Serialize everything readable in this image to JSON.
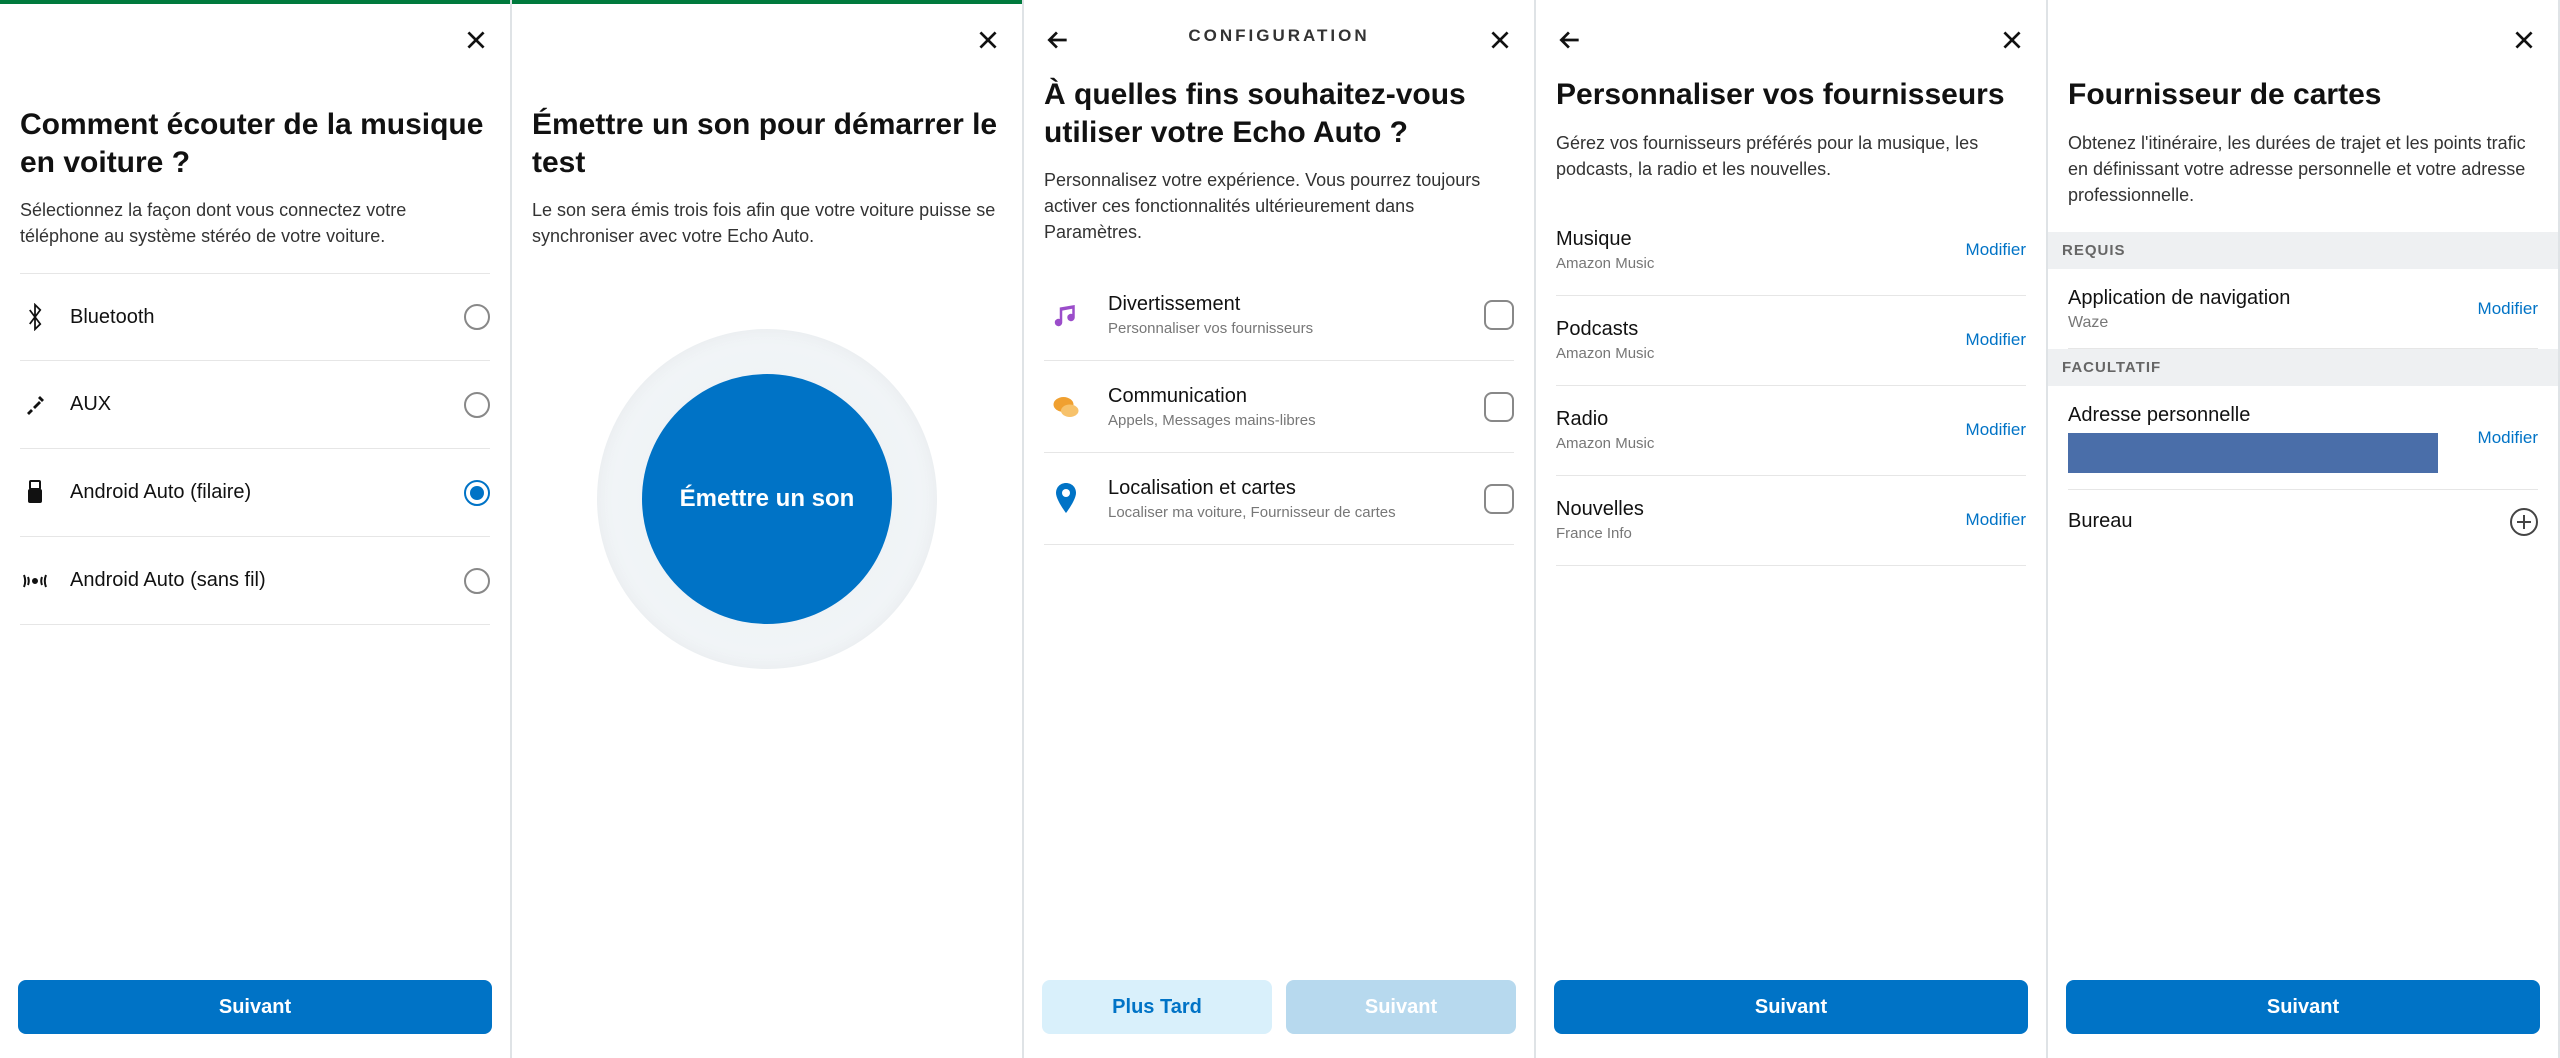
{
  "screen1": {
    "title": "Comment écouter de la musique en voiture ?",
    "subtitle": "Sélectionnez la façon dont vous connectez votre téléphone au système stéréo de votre voiture.",
    "options": [
      {
        "label": "Bluetooth",
        "icon": "bluetooth-icon",
        "selected": false
      },
      {
        "label": "AUX",
        "icon": "aux-icon",
        "selected": false
      },
      {
        "label": "Android Auto (filaire)",
        "icon": "usb-icon",
        "selected": true
      },
      {
        "label": "Android Auto (sans fil)",
        "icon": "wireless-icon",
        "selected": false
      }
    ],
    "next_label": "Suivant"
  },
  "screen2": {
    "title": "Émettre un son pour démarrer le test",
    "subtitle": "Le son sera émis trois fois afin que votre voiture puisse se synchroniser avec votre Echo Auto.",
    "play_label": "Émettre un son"
  },
  "screen3": {
    "header": "CONFIGURATION",
    "title": "À quelles fins souhaitez-vous utiliser votre Echo Auto ?",
    "subtitle": "Personnalisez votre expérience. Vous pourrez toujours activer ces fonctionnalités ultérieurement dans Paramètres.",
    "items": [
      {
        "title": "Divertissement",
        "sub": "Personnaliser vos fournisseurs",
        "icon": "music-note-icon"
      },
      {
        "title": "Communication",
        "sub": "Appels, Messages mains-libres",
        "icon": "chat-icon"
      },
      {
        "title": "Localisation et cartes",
        "sub": "Localiser ma voiture, Fournisseur de cartes",
        "icon": "location-pin-icon"
      }
    ],
    "later_label": "Plus Tard",
    "next_label": "Suivant"
  },
  "screen4": {
    "title": "Personnaliser vos fournisseurs",
    "subtitle": "Gérez vos fournisseurs préférés pour la musique, les podcasts, la radio et les nouvelles.",
    "items": [
      {
        "title": "Musique",
        "sub": "Amazon Music"
      },
      {
        "title": "Podcasts",
        "sub": "Amazon Music"
      },
      {
        "title": "Radio",
        "sub": "Amazon Music"
      },
      {
        "title": "Nouvelles",
        "sub": "France Info"
      }
    ],
    "modify_label": "Modifier",
    "next_label": "Suivant"
  },
  "screen5": {
    "title": "Fournisseur de cartes",
    "subtitle": "Obtenez l'itinéraire, les durées de trajet et les points trafic en définissant votre adresse personnelle et votre adresse professionnelle.",
    "section_required": "REQUIS",
    "nav_app": {
      "title": "Application de navigation",
      "sub": "Waze"
    },
    "section_optional": "FACULTATIF",
    "home": {
      "title": "Adresse personnelle"
    },
    "office": {
      "title": "Bureau"
    },
    "modify_label": "Modifier",
    "next_label": "Suivant"
  }
}
